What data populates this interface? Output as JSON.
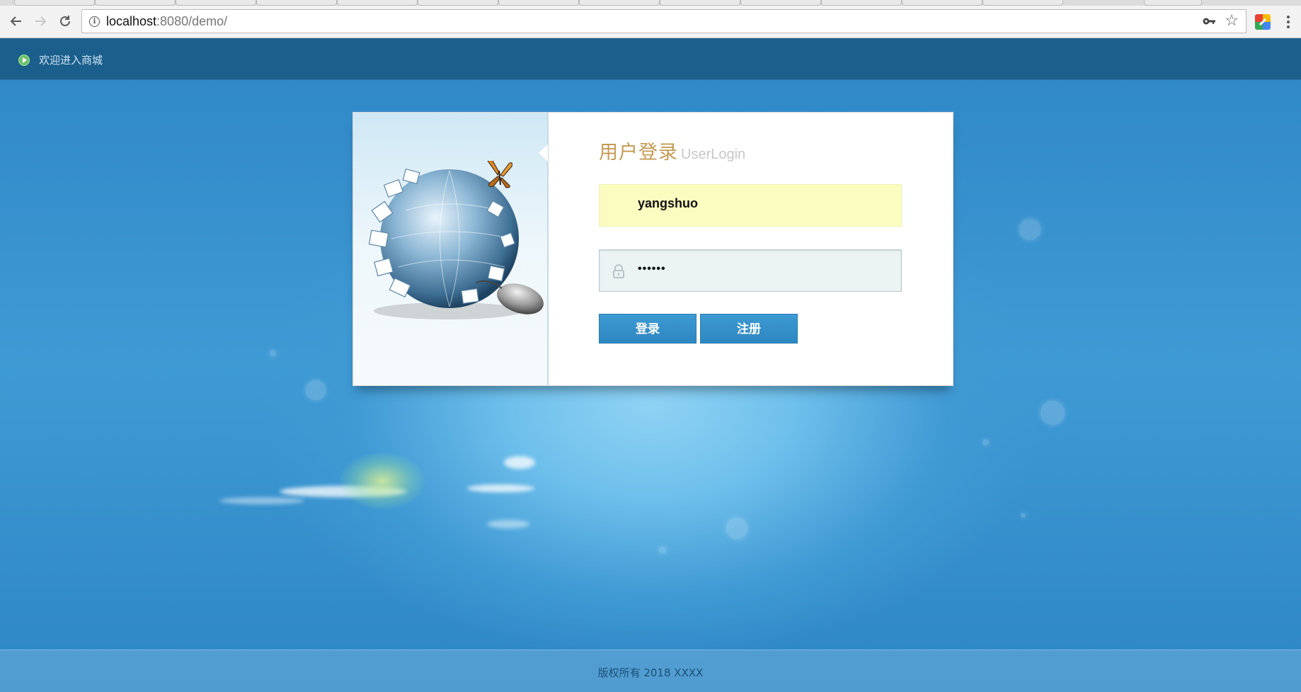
{
  "browser": {
    "url_host": "localhost",
    "url_path": ":8080/demo/"
  },
  "header": {
    "welcome_text": "欢迎进入商城"
  },
  "login": {
    "title_zh": "用户登录",
    "title_en": "UserLogin",
    "username_value": "yangshuo",
    "password_masked": "••••••",
    "login_button": "登录",
    "register_button": "注册"
  },
  "footer": {
    "copyright": "版权所有 2018 XXXX"
  }
}
